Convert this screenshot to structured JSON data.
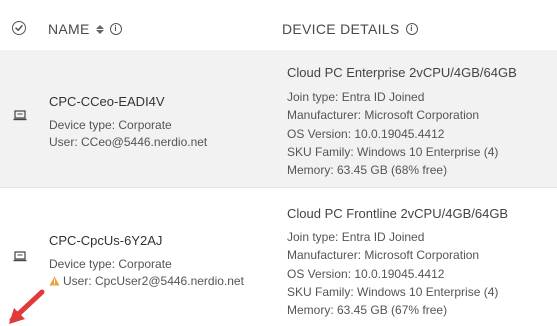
{
  "header": {
    "name_label": "NAME",
    "details_label": "DEVICE DETAILS"
  },
  "rows": [
    {
      "name": "CPC-CCeo-EADI4V",
      "device_type": "Device type: Corporate",
      "user": "User: CCeo@5446.nerdio.net",
      "details_title": "Cloud PC Enterprise 2vCPU/4GB/64GB",
      "details": [
        "Join type: Entra ID Joined",
        "Manufacturer: Microsoft Corporation",
        "OS Version: 10.0.19045.4412",
        "SKU Family: Windows 10 Enterprise (4)",
        "Memory: 63.45 GB (68% free)"
      ]
    },
    {
      "name": "CPC-CpcUs-6Y2AJ",
      "device_type": "Device type: Corporate",
      "user": "User: CpcUser2@5446.nerdio.net",
      "details_title": "Cloud PC Frontline 2vCPU/4GB/64GB",
      "details": [
        "Join type: Entra ID Joined",
        "Manufacturer: Microsoft Corporation",
        "OS Version: 10.0.19045.4412",
        "SKU Family: Windows 10 Enterprise (4)",
        "Memory: 63.45 GB (67% free)"
      ]
    }
  ],
  "icons": {
    "select_all": "check-circle-icon",
    "sort": "sort-icon",
    "info": "info-icon",
    "device": "laptop-icon",
    "warning": "warning-icon",
    "annotation": "red-arrow-icon"
  },
  "colors": {
    "row_alt_bg": "#f2f2f2",
    "warning": "#e8a33d",
    "arrow": "#e03a3a"
  }
}
